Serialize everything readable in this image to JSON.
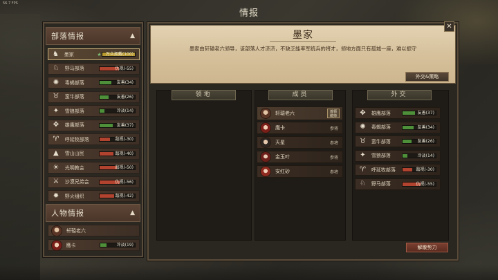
{
  "fps": "56.7 FPS",
  "screen_title": "情报",
  "left_panel": {
    "tribes_header": "部落情报",
    "tribes": [
      {
        "name": "墨家",
        "star": "★",
        "relation": "万众拥戴(100)",
        "value": 100,
        "color": "#b8992f",
        "icon": "horse-head-icon",
        "selected": true
      },
      {
        "name": "野马部落",
        "relation": "仇视(-55)",
        "value": 55,
        "color": "#b2432f",
        "icon": "wild-horse-icon"
      },
      {
        "name": "毒蝎部落",
        "relation": "友善(34)",
        "value": 34,
        "color": "#4e8f3a",
        "icon": "scorpion-icon"
      },
      {
        "name": "蛮牛部落",
        "relation": "友善(26)",
        "value": 26,
        "color": "#4e8f3a",
        "icon": "bull-icon"
      },
      {
        "name": "雪狼部落",
        "relation": "冷淡(14)",
        "value": 14,
        "color": "#4e8f3a",
        "icon": "wolf-icon"
      },
      {
        "name": "雄鹰部落",
        "relation": "友善(37)",
        "value": 37,
        "color": "#4e8f3a",
        "icon": "eagle-icon"
      },
      {
        "name": "呼延牧部落",
        "relation": "敌视(-30)",
        "value": 30,
        "color": "#b2432f",
        "icon": "ram-icon"
      },
      {
        "name": "雪山山民",
        "relation": "敌视(-40)",
        "value": 40,
        "color": "#b2432f",
        "icon": "mountain-icon"
      },
      {
        "name": "光明教会",
        "relation": "敌视(-50)",
        "value": 50,
        "color": "#b2432f",
        "icon": "sun-icon"
      },
      {
        "name": "沙漠兄弟会",
        "relation": "仇视(-56)",
        "value": 56,
        "color": "#b2432f",
        "icon": "crossed-swords-icon"
      },
      {
        "name": "野火组织",
        "relation": "敌视(-42)",
        "value": 42,
        "color": "#b2432f",
        "icon": "flame-icon"
      }
    ],
    "people_header": "人物情报",
    "people": [
      {
        "name": "轩辕老六",
        "relation": ""
      },
      {
        "name": "鹰卡",
        "relation": "冷淡(19)",
        "value": 19
      }
    ]
  },
  "faction": {
    "name": "墨家",
    "description": "墨家由轩辕老六领导，该部落人才济济，不缺乏能率军统兵的将才，领地方面只有孤城一座，难以扼守",
    "diplomacy_button": "外交&策略",
    "dissolve_button": "解散势力"
  },
  "columns": {
    "territory": "领地",
    "members": "成员",
    "diplomacy": "外交"
  },
  "members": [
    {
      "name": "轩辕老六",
      "role": "",
      "leader_tag": "首领 统帅",
      "avatar": "a"
    },
    {
      "name": "鹰卡",
      "role": "参将",
      "avatar": "b"
    },
    {
      "name": "天星",
      "role": "参将",
      "avatar": "c"
    },
    {
      "name": "金玉叶",
      "role": "参将",
      "avatar": "d"
    },
    {
      "name": "安红砂",
      "role": "参将",
      "avatar": "e"
    }
  ],
  "diplomacy": [
    {
      "name": "雄鹰部落",
      "relation": "友善(37)",
      "value": 37,
      "color": "#4e8f3a",
      "icon": "eagle-icon"
    },
    {
      "name": "毒蝎部落",
      "relation": "友善(34)",
      "value": 34,
      "color": "#4e8f3a",
      "icon": "scorpion-icon"
    },
    {
      "name": "蛮牛部落",
      "relation": "友善(26)",
      "value": 26,
      "color": "#4e8f3a",
      "icon": "bull-icon"
    },
    {
      "name": "雪狼部落",
      "relation": "冷淡(14)",
      "value": 14,
      "color": "#4e8f3a",
      "icon": "wolf-icon"
    },
    {
      "name": "呼延牧部落",
      "relation": "敌视(-30)",
      "value": 30,
      "color": "#b2432f",
      "icon": "ram-icon"
    },
    {
      "name": "野马部落",
      "relation": "仇视(-55)",
      "value": 55,
      "color": "#b2432f",
      "icon": "wild-horse-icon"
    }
  ]
}
